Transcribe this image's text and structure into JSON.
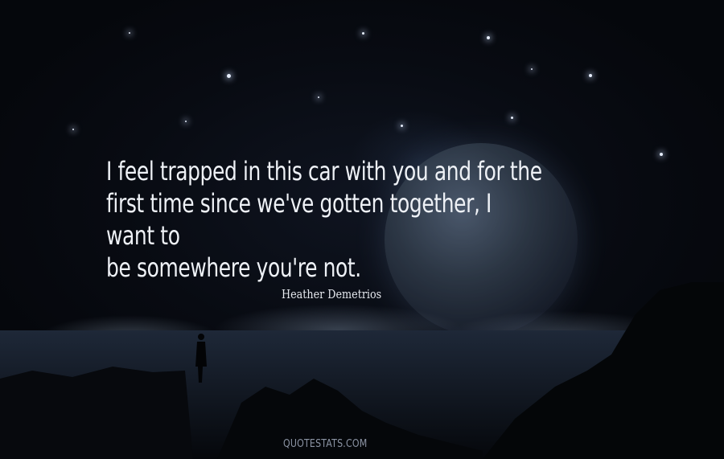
{
  "quote": {
    "line1": "I feel trapped in this car with you and for the",
    "line2": "first time since we've gotten together, I want to",
    "line3": "be somewhere you're not."
  },
  "author": "Heather Demetrios",
  "watermark": "QUOTESTATS.COM"
}
